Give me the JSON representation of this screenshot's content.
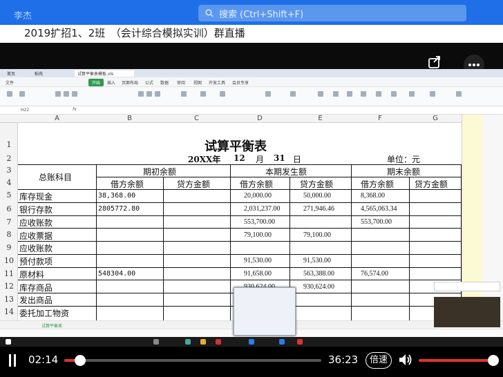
{
  "header": {
    "user_name": "李杰",
    "search_placeholder": "搜索 (Ctrl+Shift+F)",
    "group_title": "2019扩招1、2班　（会计综合模拟实训）群直播"
  },
  "wps": {
    "tabs": [
      "首页",
      "稻壳",
      "试算平衡表模板.xls"
    ],
    "ribbon_tabs": [
      "文件",
      "开始",
      "插入",
      "页面布局",
      "公式",
      "数据",
      "审阅",
      "视图",
      "开发工具",
      "会员专享"
    ],
    "cell_ref": "H22",
    "fx": "fx",
    "sheet_tab": "试算平衡表",
    "column_headers": [
      "A",
      "B",
      "C",
      "D",
      "E",
      "F",
      "G"
    ],
    "row_headers": [
      "1",
      "2",
      "3",
      "4",
      "5",
      "6",
      "7",
      "8",
      "9",
      "10",
      "11",
      "12",
      "13",
      "14"
    ]
  },
  "sheet": {
    "title": "试算平衡表",
    "year": "20XX年",
    "month_num": "12",
    "month_label": "月",
    "day_num": "31",
    "day_label": "日",
    "unit": "单位：元",
    "account_header": "总账科目",
    "group_opening": "期初余额",
    "group_current": "本期发生额",
    "group_ending": "期末余额",
    "debit": "借方余额",
    "credit": "贷方金额",
    "rows": [
      {
        "name": "库存现金",
        "b": "38,368.00",
        "c": "",
        "d": "20,000.00",
        "e": "50,000.00",
        "f": "8,368.00",
        "g": ""
      },
      {
        "name": "银行存款",
        "b": "2805772.80",
        "c": "",
        "d": "2,031,237.00",
        "e": "271,946.46",
        "f": "4,565,063.34",
        "g": ""
      },
      {
        "name": "应收账款",
        "b": "",
        "c": "",
        "d": "553,700.00",
        "e": "",
        "f": "553,700.00",
        "g": ""
      },
      {
        "name": "应收票据",
        "b": "",
        "c": "",
        "d": "79,100.00",
        "e": "79,100.00",
        "f": "",
        "g": ""
      },
      {
        "name": "应收账款",
        "b": "",
        "c": "",
        "d": "",
        "e": "",
        "f": "",
        "g": ""
      },
      {
        "name": "预付款项",
        "b": "",
        "c": "",
        "d": "91,530.00",
        "e": "91,530.00",
        "f": "",
        "g": ""
      },
      {
        "name": "原材料",
        "b": "548304.00",
        "c": "",
        "d": "91,658.00",
        "e": "563,388.00",
        "f": "76,574.00",
        "g": ""
      },
      {
        "name": "库存商品",
        "b": "",
        "c": "",
        "d": "930,624.00",
        "e": "930,624.00",
        "f": "",
        "g": ""
      },
      {
        "name": "发出商品",
        "b": "",
        "c": "",
        "d": "",
        "e": "",
        "f": "",
        "g": ""
      },
      {
        "name": "委托加工物资",
        "b": "",
        "c": "",
        "d": "",
        "e": "",
        "f": "",
        "g": ""
      }
    ]
  },
  "player": {
    "current_time": "02:14",
    "total_time": "36:23",
    "speed_label": "倍速",
    "progress": 0.061,
    "volume": 1.0
  },
  "colors": {
    "topbar": "#1e6fe8",
    "progress": "#e0342b",
    "wps_green": "#2e9a4c"
  }
}
